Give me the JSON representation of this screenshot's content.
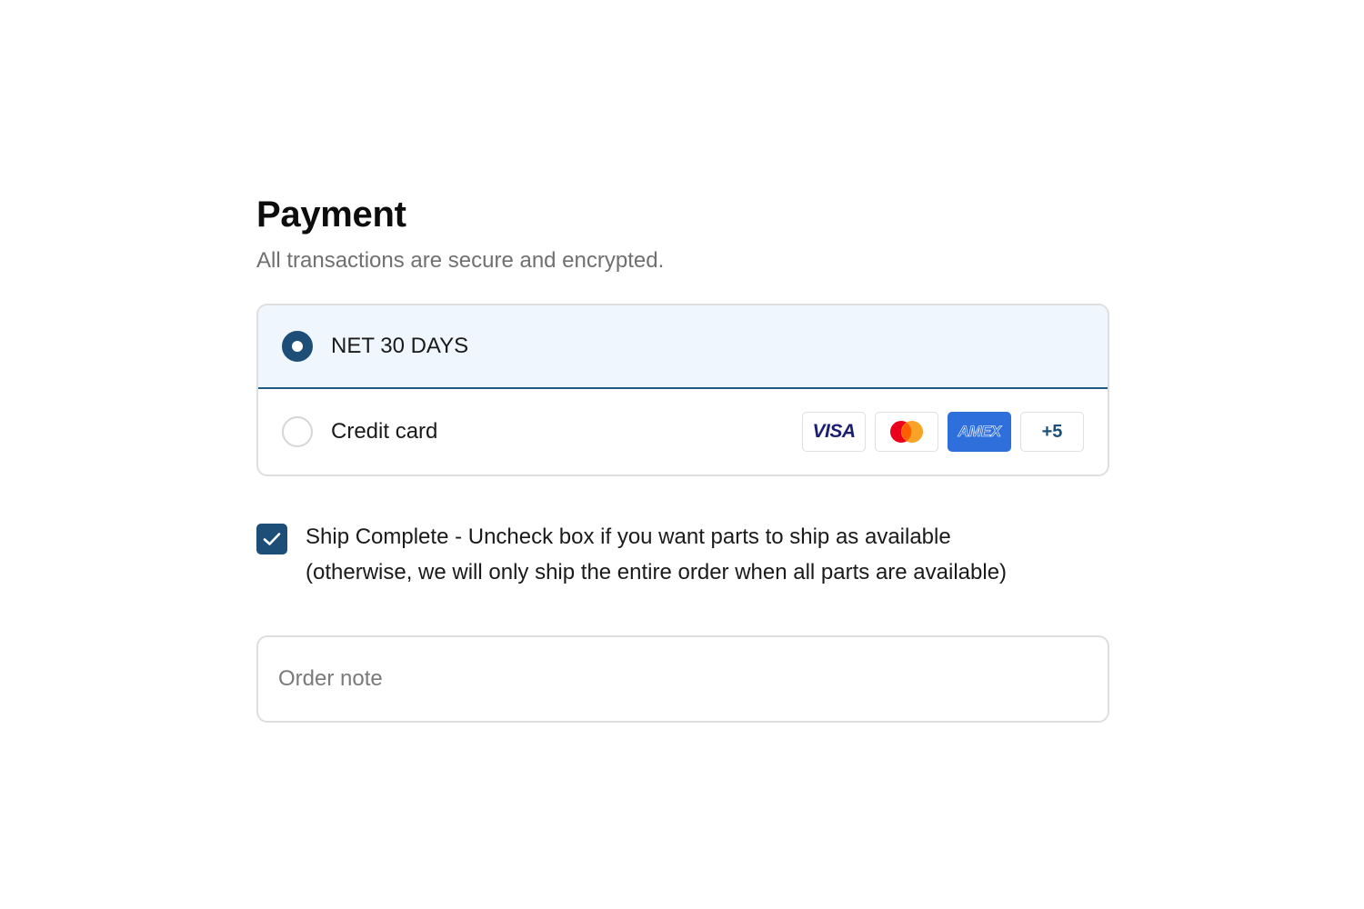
{
  "payment": {
    "title": "Payment",
    "subtitle": "All transactions are secure and encrypted.",
    "options": [
      {
        "label": "NET 30 DAYS",
        "selected": true
      },
      {
        "label": "Credit card",
        "selected": false
      }
    ],
    "card_icons": [
      {
        "name": "visa-icon",
        "text": "VISA"
      },
      {
        "name": "mastercard-icon",
        "text": ""
      },
      {
        "name": "amex-icon",
        "text": "AMEX"
      },
      {
        "name": "more-cards-badge",
        "text": "+5"
      }
    ]
  },
  "ship_complete": {
    "checked": true,
    "label": "Ship Complete - Uncheck box if you want parts to ship as available",
    "label_line2": "(otherwise, we will only ship the entire order when all parts are available)"
  },
  "order_note": {
    "placeholder": "Order note",
    "value": ""
  },
  "colors": {
    "accent": "#1d4e78",
    "selected_bg": "#f0f6fd",
    "amex": "#2f6fdb",
    "visa": "#1a1f71",
    "mc_red": "#eb001b",
    "mc_orange": "#f79e1b"
  }
}
